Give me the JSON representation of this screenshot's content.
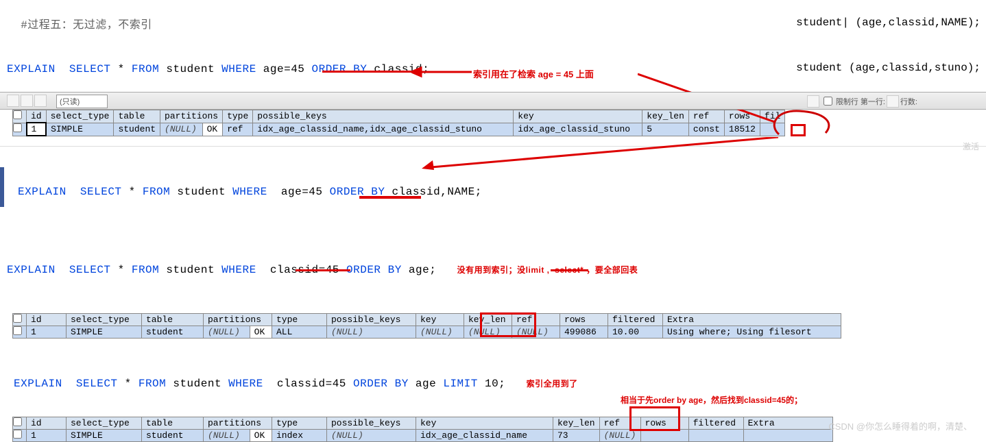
{
  "header_comment": "#过程五：无过滤，不索引",
  "top_right_1": "student| (age,classid,NAME);",
  "top_right_2": "student (age,classid,stuno);",
  "sql1_explain": "EXPLAIN",
  "sql1_select": "SELECT",
  "sql1_star": " * ",
  "sql1_from": "FROM",
  "sql1_tbl": " student ",
  "sql1_where": "WHERE",
  "sql1_cond": " age=45 ",
  "sql1_order": "ORDER BY",
  "sql1_col": " classid;",
  "anno1": "索引用在了检索 age = 45 上面",
  "toolbar": {
    "dd": "(只读)",
    "right": "限制行   第一行:",
    "rows": "行数:"
  },
  "table1": {
    "headers": [
      "id",
      "select_type",
      "table",
      "partitions",
      "",
      "type",
      "possible_keys",
      "key",
      "key_len",
      "ref",
      "rows",
      "fil"
    ],
    "row": [
      "1",
      "SIMPLE",
      "student",
      "(NULL)",
      "OK",
      "ref",
      "idx_age_classid_name,idx_age_classid_stuno",
      "idx_age_classid_stuno",
      "5",
      "const",
      "18512",
      ""
    ]
  },
  "sql2_explain": "EXPLAIN",
  "sql2_select": "SELECT",
  "sql2_from": "FROM",
  "sql2_tbl": " student ",
  "sql2_where": "WHERE",
  "sql2_cond": "  age=45 ",
  "sql2_order": "ORDER BY",
  "sql2_col": " classid,NAME;",
  "sql3_explain": "EXPLAIN",
  "sql3_select": "SELECT",
  "sql3_from": "FROM",
  "sql3_tbl": " student ",
  "sql3_where": "WHERE",
  "sql3_cond": "  classid=45 ",
  "sql3_order": "ORDER BY",
  "sql3_col": " age;",
  "anno3": "没有用到索引；没limit ,  select* ，要全部回表",
  "table2": {
    "headers": [
      "id",
      "select_type",
      "table",
      "partitions",
      "",
      "type",
      "possible_keys",
      "key",
      "key_len",
      "ref",
      "rows",
      "filtered",
      "Extra"
    ],
    "row": [
      "1",
      "SIMPLE",
      "student",
      "(NULL)",
      "OK",
      "ALL",
      "(NULL)",
      "(NULL)",
      "(NULL)",
      "(NULL)",
      "499086",
      "10.00",
      "Using where; Using filesort"
    ]
  },
  "sql4_explain": "EXPLAIN",
  "sql4_select": "SELECT",
  "sql4_from": "FROM",
  "sql4_tbl": " student ",
  "sql4_where": "WHERE",
  "sql4_cond": "  classid=45 ",
  "sql4_order": "ORDER BY",
  "sql4_col": " age ",
  "sql4_limit": "LIMIT",
  "sql4_n": " 10;",
  "anno4a": "索引全用到了",
  "anno4b": "相当于先order by age，然后找到classid=45的；",
  "table3": {
    "headers": [
      "id",
      "select_type",
      "table",
      "partitions",
      "",
      "type",
      "possible_keys",
      "key",
      "key_len",
      "ref",
      "rows",
      "filtered",
      "Extra"
    ],
    "row": [
      "1",
      "SIMPLE",
      "student",
      "(NULL)",
      "OK",
      "index",
      "(NULL)",
      "idx_age_classid_name",
      "73",
      "(NULL)",
      "",
      "",
      ""
    ]
  },
  "activate_text": "激活",
  "watermark": "CSDN @你怎么睡得着的啊，清楚、"
}
